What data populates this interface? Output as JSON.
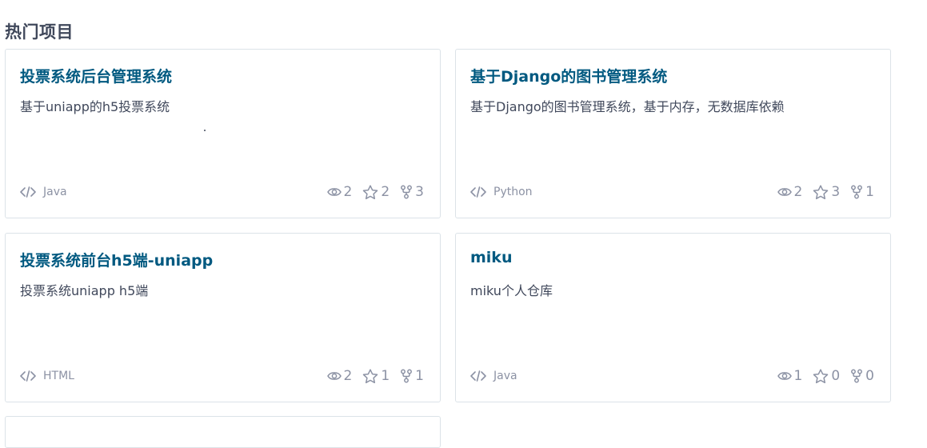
{
  "section": {
    "title": "热门项目"
  },
  "projects": [
    {
      "title": "投票系统后台管理系统",
      "description": "基于uniapp的h5投票系统",
      "language": "Java",
      "watchers": "2",
      "stars": "2",
      "forks": "3"
    },
    {
      "title": "基于Django的图书管理系统",
      "description": "基于Django的图书管理系统，基于内存，无数据库依赖",
      "language": "Python",
      "watchers": "2",
      "stars": "3",
      "forks": "1"
    },
    {
      "title": "投票系统前台h5端-uniapp",
      "description": "投票系统uniapp h5端",
      "language": "HTML",
      "watchers": "2",
      "stars": "1",
      "forks": "1"
    },
    {
      "title": "miku",
      "description": "miku个人仓库",
      "language": "Java",
      "watchers": "1",
      "stars": "0",
      "forks": "0"
    }
  ],
  "colors": {
    "title": "#005980",
    "text": "#40485b",
    "muted": "#8c92a4",
    "border": "#dce3e8"
  },
  "icons": [
    "code-icon",
    "eye-icon",
    "star-icon",
    "fork-icon"
  ]
}
